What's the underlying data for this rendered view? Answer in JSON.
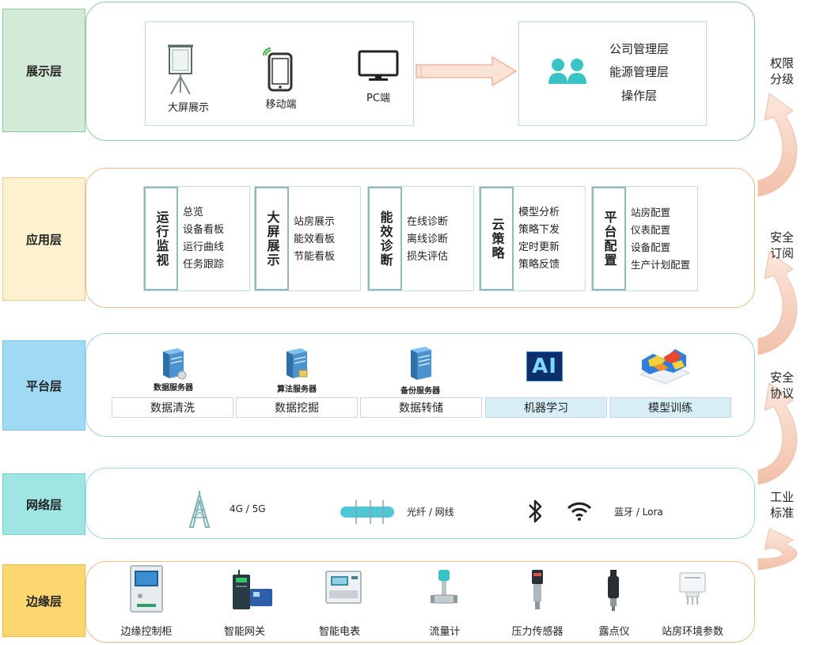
{
  "colors": {
    "display": "#d3ead9",
    "application": "#fdf1cf",
    "platform": "#9fd9f4",
    "network": "#9fe5e4",
    "edge": "#fcd770",
    "display_border": "#8ccaa0",
    "application_border": "#f0b98a",
    "platform_border": "#9fd0de",
    "network_border": "#9fd8da",
    "edge_border": "#f0b98a",
    "arrow": "#f3c4b4",
    "accent": "#39c3c6"
  },
  "layers": {
    "display": "展示层",
    "application": "应用层",
    "platform": "平台层",
    "network": "网络层",
    "edge": "边缘层"
  },
  "display": {
    "terminals": [
      {
        "label": "大屏展示",
        "icon": "presentation-screen-icon"
      },
      {
        "label": "移动端",
        "icon": "smartphone-icon"
      },
      {
        "label": "PC端",
        "icon": "monitor-icon"
      }
    ],
    "roles": [
      "公司管理层",
      "能源管理层",
      "操作层"
    ]
  },
  "application": {
    "modules": [
      {
        "title": "运行监视",
        "items": [
          "总览",
          "设备看板",
          "运行曲线",
          "任务跟踪"
        ]
      },
      {
        "title": "大屏展示",
        "items": [
          "站房展示",
          "能效看板",
          "节能看板"
        ]
      },
      {
        "title": "能效诊断",
        "items": [
          "在线诊断",
          "离线诊断",
          "损失评估"
        ]
      },
      {
        "title": "云策略",
        "items": [
          "模型分析",
          "策略下发",
          "定时更新",
          "策略反馈"
        ]
      },
      {
        "title": "平台配置",
        "items": [
          "站房配置",
          "仪表配置",
          "设备配置",
          "生产计划配置"
        ]
      }
    ]
  },
  "platform": {
    "servers": [
      "数据服务器",
      "算法服务器",
      "备份服务器"
    ],
    "ai_text": "AI",
    "boxes": [
      "数据清洗",
      "数据挖掘",
      "数据转储",
      "机器学习",
      "模型训练"
    ]
  },
  "network": {
    "cell": "4G / 5G",
    "fiber": "光纤 / 网线",
    "wireless": "蓝牙 / Lora"
  },
  "edge": {
    "devices": [
      "边缘控制柜",
      "智能网关",
      "智能电表",
      "流量计",
      "压力传感器",
      "露点仪",
      "站房环境参数"
    ]
  },
  "side": [
    "权限\n分级",
    "安全\n订阅",
    "安全\n协议",
    "工业\n标准"
  ]
}
